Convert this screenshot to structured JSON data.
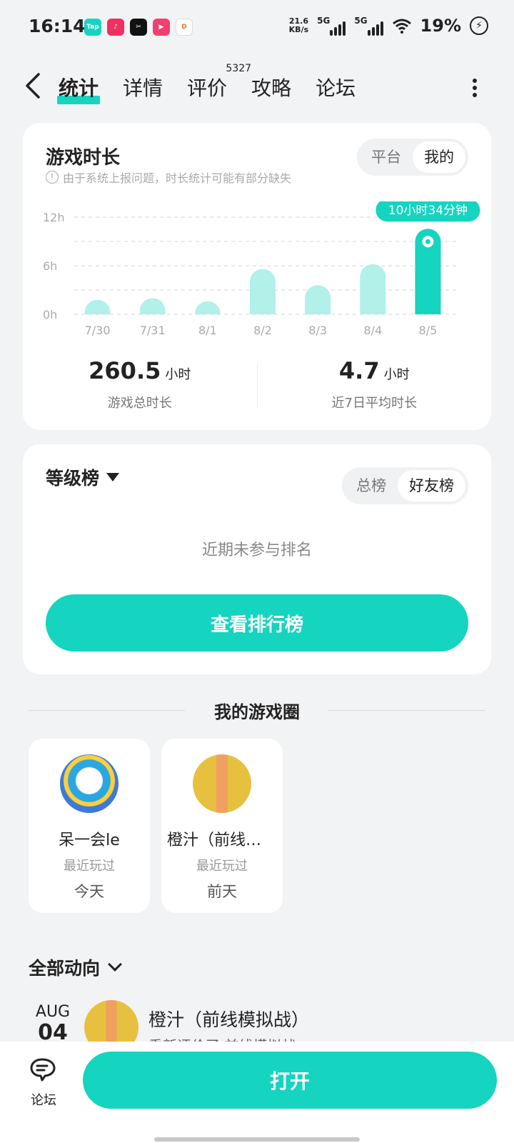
{
  "status_bar": {
    "time": "16:14",
    "apps": [
      {
        "icon": "taptap-icon",
        "label": "Tap",
        "color": "#15d4c0"
      },
      {
        "icon": "douyin-icon",
        "label": "♪",
        "color": "#f03060"
      },
      {
        "icon": "capcut-icon",
        "label": "✂",
        "color": "#111111"
      },
      {
        "icon": "video-icon",
        "label": "▶",
        "color": "#f04070"
      },
      {
        "icon": "didi-icon",
        "label": "D",
        "color": "#ffffff"
      }
    ],
    "speed_value": "21.6",
    "speed_unit": "KB/s",
    "net1": "5G",
    "net2": "5G",
    "battery": "19%"
  },
  "nav": {
    "tabs": [
      {
        "label": "统计"
      },
      {
        "label": "详情"
      },
      {
        "label": "评价",
        "badge": "5327"
      },
      {
        "label": "攻略"
      },
      {
        "label": "论坛"
      }
    ]
  },
  "playtime": {
    "title": "游戏时长",
    "notice": "由于系统上报问题，时长统计可能有部分缺失",
    "toggle": [
      "平台",
      "我的"
    ],
    "total_value": "260.5",
    "total_unit": "小时",
    "total_label": "游戏总时长",
    "avg_value": "4.7",
    "avg_unit": "小时",
    "avg_label": "近7日平均时长"
  },
  "chart_data": {
    "type": "bar",
    "categories": [
      "7/30",
      "7/31",
      "8/1",
      "8/2",
      "8/3",
      "8/4",
      "8/5"
    ],
    "values": [
      1.8,
      2.0,
      1.6,
      5.6,
      3.6,
      6.2,
      10.57
    ],
    "ylim": [
      0,
      12
    ],
    "yticks": [
      "12h",
      "6h",
      "0h"
    ],
    "highlight_index": 6,
    "highlight_label": "10小时34分钟",
    "colors": {
      "bar": "#b2f0ea",
      "highlight": "#15d4c0"
    },
    "grid": true
  },
  "ranking": {
    "title": "等级榜",
    "toggle": [
      "总榜",
      "好友榜"
    ],
    "empty_text": "近期未参与排名",
    "button": "查看排行榜"
  },
  "circle": {
    "section_title": "我的游戏圈",
    "friends": [
      {
        "name": "呆一会le",
        "label": "最近玩过",
        "time": "今天"
      },
      {
        "name": "橙汁（前线模拟战）",
        "label": "最近玩过",
        "time": "前天"
      }
    ]
  },
  "feed": {
    "filter": "全部动向",
    "month": "AUG",
    "day": "04",
    "name": "橙汁（前线模拟战）",
    "action": "重新评价了 前线模拟战"
  },
  "bottom": {
    "forum_label": "论坛",
    "open_button": "打开"
  },
  "colors": {
    "accent": "#15d4c0",
    "bg": "#f2f3f5"
  }
}
